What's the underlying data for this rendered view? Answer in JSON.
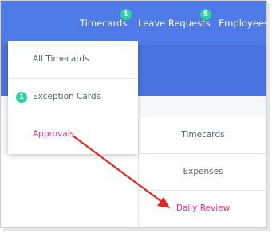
{
  "nav": {
    "items": [
      {
        "label": "Timecards",
        "badge": "1"
      },
      {
        "label": "Leave Requests",
        "badge": "5"
      },
      {
        "label": "Employees"
      }
    ]
  },
  "dropdown": {
    "items": [
      {
        "label": "All Timecards"
      },
      {
        "label": "Exception Cards",
        "badge": "1"
      },
      {
        "label": "Approvals"
      }
    ]
  },
  "panel": {
    "rows": [
      {
        "label": "Timecards"
      },
      {
        "label": "Expenses"
      },
      {
        "label": "Daily Review"
      }
    ]
  },
  "colors": {
    "header_blue": "#4e7be8",
    "badge_green": "#2ed29f",
    "active_pink": "#e2338f",
    "annotation_arrow": "#e8261f"
  }
}
